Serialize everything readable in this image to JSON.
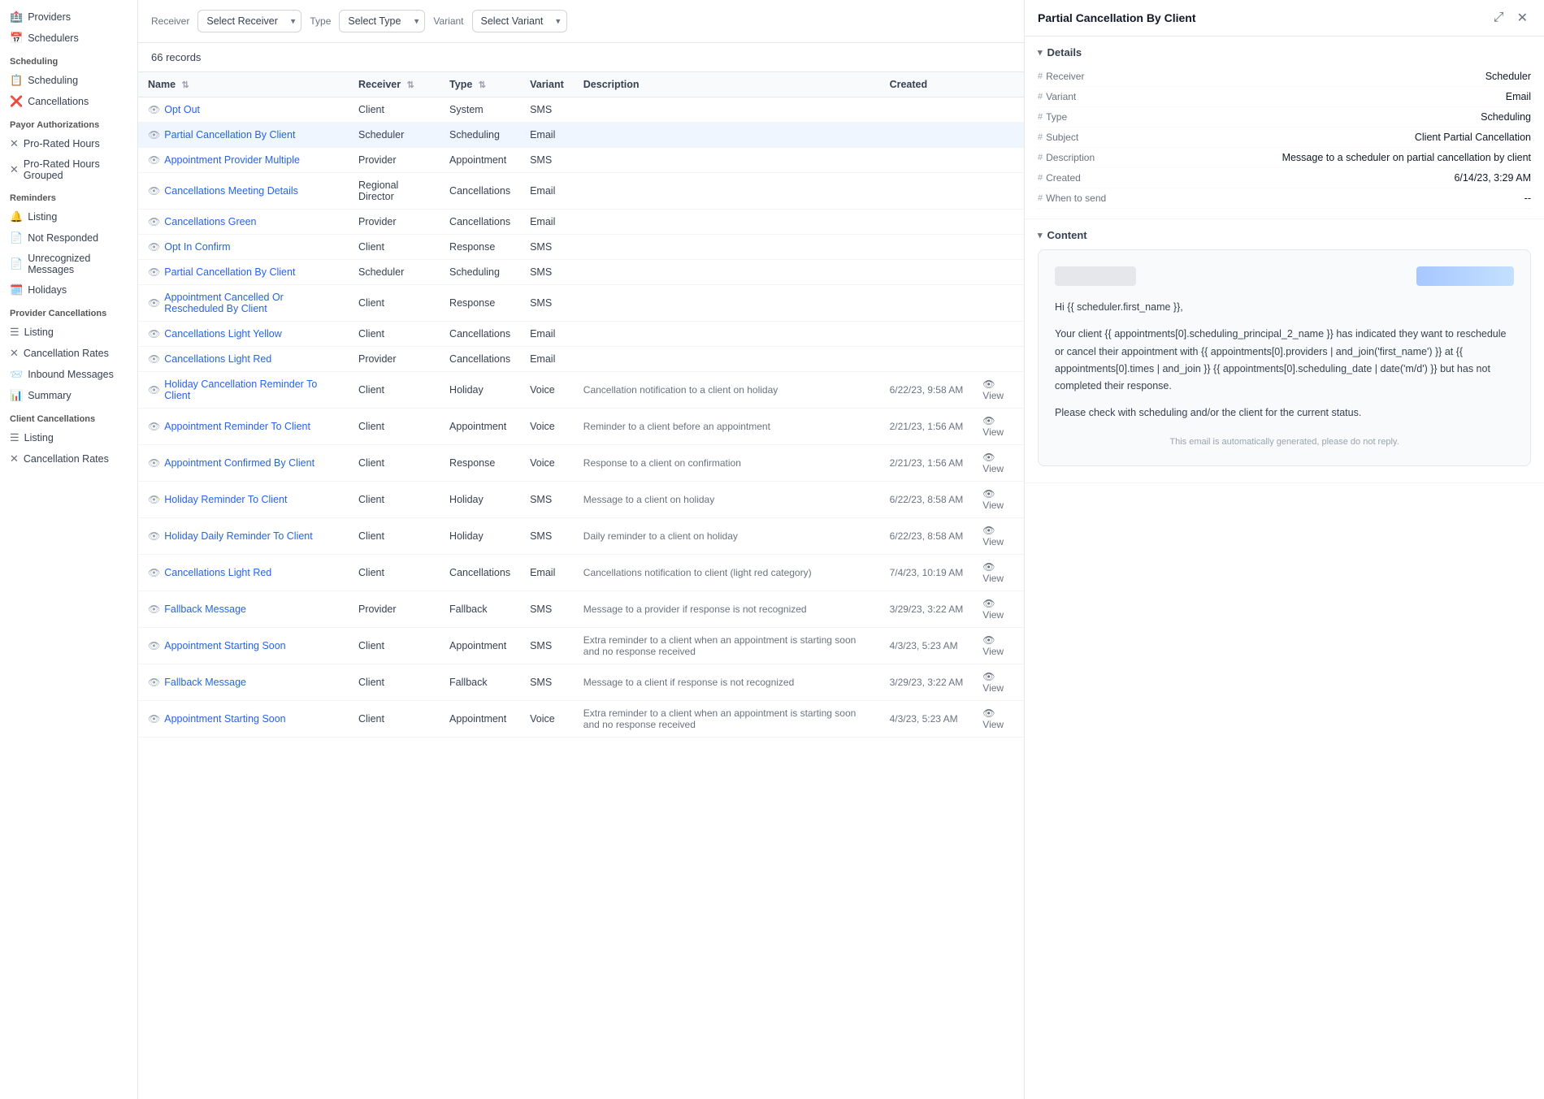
{
  "sidebar": {
    "sections": [
      {
        "title": "",
        "items": [
          {
            "label": "Providers",
            "icon": "🏥",
            "active": false
          },
          {
            "label": "Schedulers",
            "icon": "📅",
            "active": false
          }
        ]
      },
      {
        "title": "Scheduling",
        "items": [
          {
            "label": "Scheduling",
            "icon": "📋",
            "active": false
          },
          {
            "label": "Cancellations",
            "icon": "❌",
            "active": false
          }
        ]
      },
      {
        "title": "Payor Authorizations",
        "items": [
          {
            "label": "Pro-Rated Hours",
            "icon": "✕",
            "active": false
          },
          {
            "label": "Pro-Rated Hours Grouped",
            "icon": "✕",
            "active": false
          }
        ]
      },
      {
        "title": "Reminders",
        "items": [
          {
            "label": "Listing",
            "icon": "🔔",
            "active": false
          },
          {
            "label": "Not Responded",
            "icon": "📄",
            "active": false
          },
          {
            "label": "Unrecognized Messages",
            "icon": "📄",
            "active": false
          },
          {
            "label": "Holidays",
            "icon": "🗓️",
            "active": false
          }
        ]
      },
      {
        "title": "Provider Cancellations",
        "items": [
          {
            "label": "Listing",
            "icon": "☰",
            "active": false
          },
          {
            "label": "Cancellation Rates",
            "icon": "✕",
            "active": false
          },
          {
            "label": "Inbound Messages",
            "icon": "📨",
            "active": false
          },
          {
            "label": "Summary",
            "icon": "📊",
            "active": false
          }
        ]
      },
      {
        "title": "Client Cancellations",
        "items": [
          {
            "label": "Listing",
            "icon": "☰",
            "active": false
          },
          {
            "label": "Cancellation Rates",
            "icon": "✕",
            "active": false
          }
        ]
      }
    ]
  },
  "filters": {
    "receiver_label": "Receiver",
    "type_label": "Type",
    "variant_label": "Variant",
    "receiver_placeholder": "Select Receiver",
    "type_placeholder": "Select Type",
    "variant_placeholder": "Select Variant"
  },
  "records_count": "66 records",
  "table": {
    "columns": [
      "Name",
      "Receiver",
      "Type",
      "Variant",
      "Description",
      "Created",
      ""
    ],
    "rows": [
      {
        "name": "Opt Out",
        "receiver": "Client",
        "type": "System",
        "variant": "SMS",
        "description": "",
        "created": "",
        "highlighted": false
      },
      {
        "name": "Partial Cancellation By Client",
        "receiver": "Scheduler",
        "type": "Scheduling",
        "variant": "Email",
        "description": "",
        "created": "",
        "highlighted": true
      },
      {
        "name": "Appointment Provider Multiple",
        "receiver": "Provider",
        "type": "Appointment",
        "variant": "SMS",
        "description": "",
        "created": "",
        "highlighted": false
      },
      {
        "name": "Cancellations Meeting Details",
        "receiver": "Regional Director",
        "type": "Cancellations",
        "variant": "Email",
        "description": "",
        "created": "",
        "highlighted": false
      },
      {
        "name": "Cancellations Green",
        "receiver": "Provider",
        "type": "Cancellations",
        "variant": "Email",
        "description": "",
        "created": "",
        "highlighted": false
      },
      {
        "name": "Opt In Confirm",
        "receiver": "Client",
        "type": "Response",
        "variant": "SMS",
        "description": "",
        "created": "",
        "highlighted": false
      },
      {
        "name": "Partial Cancellation By Client",
        "receiver": "Scheduler",
        "type": "Scheduling",
        "variant": "SMS",
        "description": "",
        "created": "",
        "highlighted": false
      },
      {
        "name": "Appointment Cancelled Or Rescheduled By Client",
        "receiver": "Client",
        "type": "Response",
        "variant": "SMS",
        "description": "",
        "created": "",
        "highlighted": false
      },
      {
        "name": "Cancellations Light Yellow",
        "receiver": "Client",
        "type": "Cancellations",
        "variant": "Email",
        "description": "",
        "created": "",
        "highlighted": false
      },
      {
        "name": "Cancellations Light Red",
        "receiver": "Provider",
        "type": "Cancellations",
        "variant": "Email",
        "description": "",
        "created": "",
        "highlighted": false
      },
      {
        "name": "Holiday Cancellation Reminder To Client",
        "receiver": "Client",
        "type": "Holiday",
        "variant": "Voice",
        "description": "Cancellation notification to a client on holiday",
        "created": "6/22/23, 9:58 AM",
        "highlighted": false
      },
      {
        "name": "Appointment Reminder To Client",
        "receiver": "Client",
        "type": "Appointment",
        "variant": "Voice",
        "description": "Reminder to a client before an appointment",
        "created": "2/21/23, 1:56 AM",
        "highlighted": false
      },
      {
        "name": "Appointment Confirmed By Client",
        "receiver": "Client",
        "type": "Response",
        "variant": "Voice",
        "description": "Response to a client on confirmation",
        "created": "2/21/23, 1:56 AM",
        "highlighted": false
      },
      {
        "name": "Holiday Reminder To Client",
        "receiver": "Client",
        "type": "Holiday",
        "variant": "SMS",
        "description": "Message to a client on holiday",
        "created": "6/22/23, 8:58 AM",
        "highlighted": false
      },
      {
        "name": "Holiday Daily Reminder To Client",
        "receiver": "Client",
        "type": "Holiday",
        "variant": "SMS",
        "description": "Daily reminder to a client on holiday",
        "created": "6/22/23, 8:58 AM",
        "highlighted": false
      },
      {
        "name": "Cancellations Light Red",
        "receiver": "Client",
        "type": "Cancellations",
        "variant": "Email",
        "description": "Cancellations notification to client (light red category)",
        "created": "7/4/23, 10:19 AM",
        "highlighted": false
      },
      {
        "name": "Fallback Message",
        "receiver": "Provider",
        "type": "Fallback",
        "variant": "SMS",
        "description": "Message to a provider if response is not recognized",
        "created": "3/29/23, 3:22 AM",
        "highlighted": false
      },
      {
        "name": "Appointment Starting Soon",
        "receiver": "Client",
        "type": "Appointment",
        "variant": "SMS",
        "description": "Extra reminder to a client when an appointment is starting soon and no response received",
        "created": "4/3/23, 5:23 AM",
        "highlighted": false
      },
      {
        "name": "Fallback Message",
        "receiver": "Client",
        "type": "Fallback",
        "variant": "SMS",
        "description": "Message to a client if response is not recognized",
        "created": "3/29/23, 3:22 AM",
        "highlighted": false
      },
      {
        "name": "Appointment Starting Soon",
        "receiver": "Client",
        "type": "Appointment",
        "variant": "Voice",
        "description": "Extra reminder to a client when an appointment is starting soon and no response received",
        "created": "4/3/23, 5:23 AM",
        "highlighted": false
      }
    ]
  },
  "panel": {
    "title": "Partial Cancellation By Client",
    "details_section": "Details",
    "content_section": "Content",
    "details": {
      "receiver_label": "Receiver",
      "receiver_value": "Scheduler",
      "variant_label": "Variant",
      "variant_value": "Email",
      "type_label": "Type",
      "type_value": "Scheduling",
      "subject_label": "Subject",
      "subject_value": "Client Partial Cancellation",
      "description_label": "Description",
      "description_value": "Message to a scheduler on partial cancellation by client",
      "created_label": "Created",
      "created_value": "6/14/23, 3:29 AM",
      "when_to_send_label": "When to send",
      "when_to_send_value": "--"
    },
    "email_preview": {
      "greeting": "Hi {{ scheduler.first_name }},",
      "body_line1": "Your client {{ appointments[0].scheduling_principal_2_name }} has indicated they want to reschedule or cancel their appointment with {{ appointments[0].providers | and_join('first_name') }} at {{ appointments[0].times | and_join }} {{ appointments[0].scheduling_date | date('m/d') }} but has not completed their response.",
      "body_line2": "Please check with scheduling and/or the client for the current status.",
      "footer": "This email is automatically generated, please do not reply."
    }
  }
}
